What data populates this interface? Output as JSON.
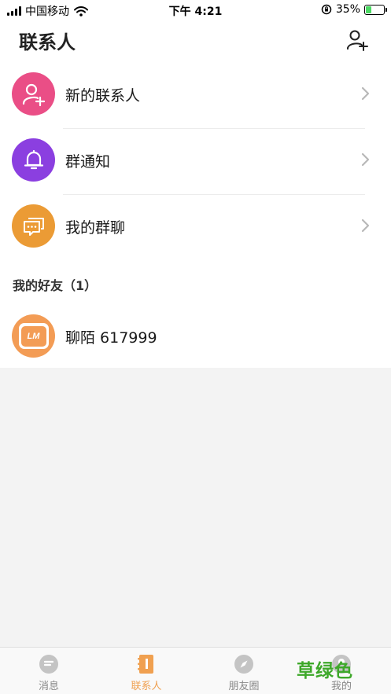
{
  "status_bar": {
    "carrier": "中国移动",
    "time": "下午 4:21",
    "battery_percent_label": "35%",
    "battery_level": 0.35
  },
  "header": {
    "title": "联系人",
    "add_icon": "person-add-icon"
  },
  "menu": [
    {
      "label": "新的联系人",
      "icon": "person-add-icon",
      "color": "#ea4e86"
    },
    {
      "label": "群通知",
      "icon": "bell-icon",
      "color": "#8b3fe0"
    },
    {
      "label": "我的群聊",
      "icon": "chat-bubbles-icon",
      "color": "#eb9b35"
    }
  ],
  "friends_section": {
    "title": "我的好友（1）",
    "items": [
      {
        "name": "聊陌 617999",
        "avatar_text": "LM",
        "avatar_color": "#f39c55"
      }
    ]
  },
  "tab_bar": {
    "tabs": [
      {
        "label": "消息",
        "icon": "message-icon",
        "active": false
      },
      {
        "label": "联系人",
        "icon": "contacts-book-icon",
        "active": true
      },
      {
        "label": "朋友圈",
        "icon": "compass-icon",
        "active": false
      },
      {
        "label": "我的",
        "icon": "profile-icon",
        "active": false
      }
    ],
    "active_color": "#f0a050",
    "inactive_color": "#888888"
  },
  "watermark": "草绿色"
}
